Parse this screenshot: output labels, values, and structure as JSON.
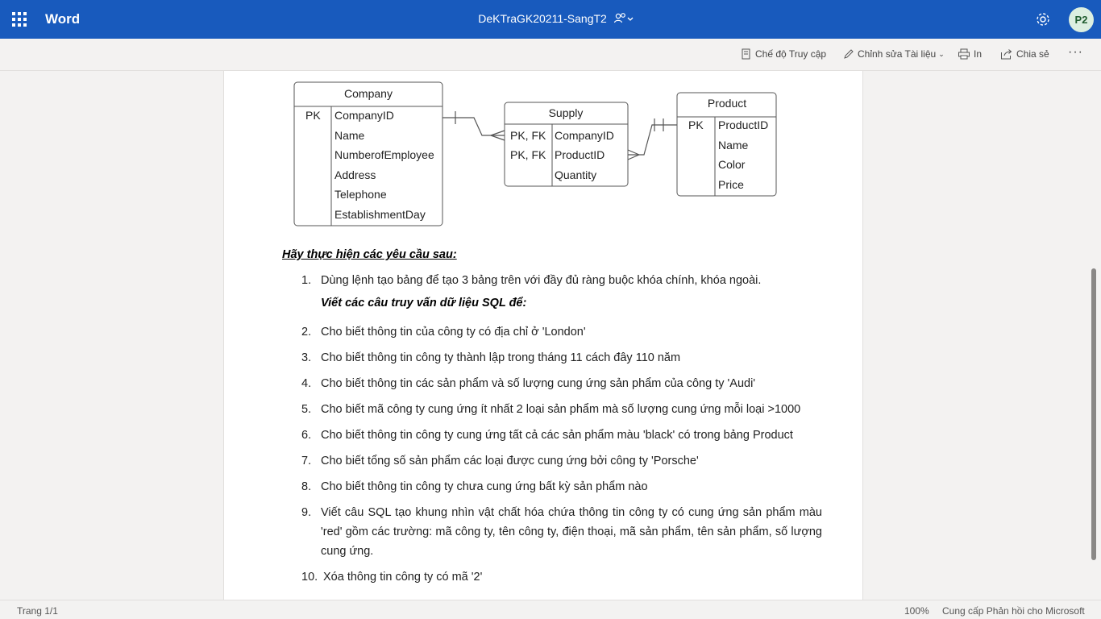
{
  "app": {
    "name": "Word",
    "doc_title": "DeKTraGK20211-SangT2",
    "avatar_initials": "P2",
    "brand_color": "#185abd"
  },
  "commands": {
    "accessibility": "Chế độ Truy cập",
    "edit": "Chỉnh sửa Tài liệu",
    "print": "In",
    "share": "Chia sẻ"
  },
  "erd": {
    "company": {
      "title": "Company",
      "keys": [
        "PK"
      ],
      "fields": [
        "CompanyID",
        "Name",
        "NumberofEmployee",
        "Address",
        "Telephone",
        "EstablishmentDay"
      ]
    },
    "supply": {
      "title": "Supply",
      "keys": [
        "PK, FK",
        "PK, FK"
      ],
      "fields": [
        "CompanyID",
        "ProductID",
        "Quantity"
      ]
    },
    "product": {
      "title": "Product",
      "keys": [
        "PK"
      ],
      "fields": [
        "ProductID",
        "Name",
        "Color",
        "Price"
      ]
    }
  },
  "doc": {
    "heading": "Hãy thực hiện các yêu cầu sau:",
    "subheading": "Viết các câu truy vấn dữ liệu SQL để:",
    "items": [
      {
        "num": "1.",
        "text": "Dùng lệnh tạo bảng để tạo 3 bảng trên với đầy đủ ràng buộc khóa chính, khóa ngoài."
      },
      {
        "num": "2.",
        "text": "Cho biết thông tin của công ty có địa chỉ ở 'London'"
      },
      {
        "num": "3.",
        "text": "Cho biết thông tin công ty thành lập trong tháng 11 cách đây 110 năm"
      },
      {
        "num": "4.",
        "text": "Cho biết thông tin các sản phẩm và số lượng cung ứng sản phẩm của công ty 'Audi'"
      },
      {
        "num": "5.",
        "text": "Cho biết mã công ty cung ứng ít nhất 2 loại sản phẩm mà số lượng cung ứng mỗi loại >1000"
      },
      {
        "num": "6.",
        "text": "Cho biết thông tin công ty cung ứng tất cả các sản phẩm màu 'black' có trong bảng Product"
      },
      {
        "num": "7.",
        "text": "Cho biết tổng số sản phẩm các loại được cung ứng bởi công ty 'Porsche'"
      },
      {
        "num": "8.",
        "text": "Cho biết thông tin công ty chưa cung ứng bất kỳ sản phẩm nào"
      },
      {
        "num": "9.",
        "text": "Viết câu SQL tạo khung nhìn vật chất hóa chứa thông tin công ty có cung ứng sản phẩm màu 'red' gồm các trường: mã công ty, tên công ty, điện thoại, mã sản phẩm, tên sản phẩm, số lượng cung ứng."
      },
      {
        "num": "10.",
        "text": "Xóa thông tin công ty có mã '2'"
      }
    ]
  },
  "status": {
    "page": "Trang 1/1",
    "zoom": "100%",
    "feedback": "Cung cấp Phản hồi cho Microsoft"
  }
}
